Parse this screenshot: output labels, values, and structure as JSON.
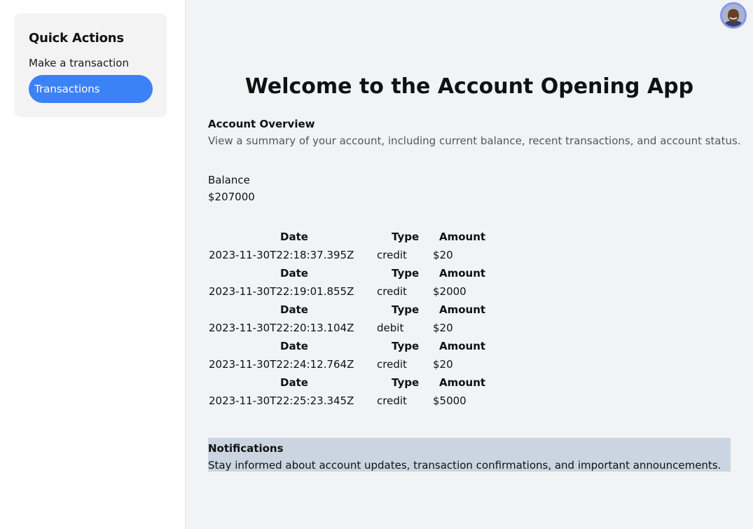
{
  "sidebar": {
    "title": "Quick Actions",
    "make_transaction": "Make a transaction",
    "transactions_button": "Transactions"
  },
  "header": {
    "avatar": "user-avatar-photo"
  },
  "main": {
    "title": "Welcome to the Account Opening App",
    "overview": {
      "heading": "Account Overview",
      "description": "View a summary of your account, including current balance, recent transactions, and account status."
    },
    "balance": {
      "label": "Balance",
      "value": "$207000"
    },
    "transactions": {
      "headers": {
        "date": "Date",
        "type": "Type",
        "amount": "Amount"
      },
      "rows": [
        {
          "date": "2023-11-30T22:18:37.395Z",
          "type": "credit",
          "amount": "$20"
        },
        {
          "date": "2023-11-30T22:19:01.855Z",
          "type": "credit",
          "amount": "$2000"
        },
        {
          "date": "2023-11-30T22:20:13.104Z",
          "type": "debit",
          "amount": "$20"
        },
        {
          "date": "2023-11-30T22:24:12.764Z",
          "type": "credit",
          "amount": "$20"
        },
        {
          "date": "2023-11-30T22:25:23.345Z",
          "type": "credit",
          "amount": "$5000"
        }
      ]
    },
    "notifications": {
      "heading": "Notifications",
      "description": "Stay informed about account updates, transaction confirmations, and important announcements."
    }
  },
  "colors": {
    "accent": "#3b82f6",
    "notification_bg": "#cbd5e1",
    "main_bg": "#f2f3f5"
  }
}
